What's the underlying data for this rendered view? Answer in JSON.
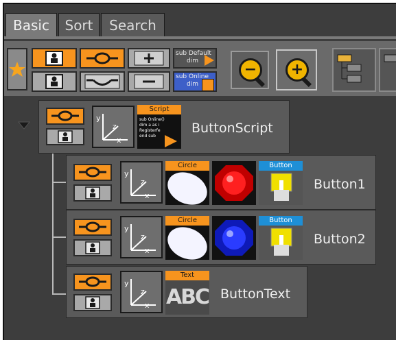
{
  "tabs": [
    {
      "label": "Basic",
      "active": true
    },
    {
      "label": "Sort",
      "active": false
    },
    {
      "label": "Search",
      "active": false
    }
  ],
  "toolbar": {
    "script_default_tag": "sub Default",
    "script_default_sub": "dim",
    "script_online_tag": "sub Online",
    "script_online_sub": "dim"
  },
  "tree": {
    "root": {
      "name": "ButtonScript",
      "thumb_tag": "Script",
      "thumb_code": [
        "sub Online()",
        "dim a as i",
        "Registerfe",
        "end sub"
      ]
    },
    "children": [
      {
        "name": "Button1",
        "shape_tag": "Circle",
        "button_tag": "Button",
        "ball_color": "#d80000",
        "ball_bg": "#b00000"
      },
      {
        "name": "Button2",
        "shape_tag": "Circle",
        "button_tag": "Button",
        "ball_color": "#1a2ee8",
        "ball_bg": "#0e1ab8"
      },
      {
        "name": "ButtonText",
        "text_tag": "Text",
        "text_thumb": "ABC"
      }
    ]
  },
  "colors": {
    "accent": "#f7941e",
    "panel": "#3d3d3d",
    "tag_orange": "#f7941e",
    "tag_blue": "#1e8fd6"
  }
}
